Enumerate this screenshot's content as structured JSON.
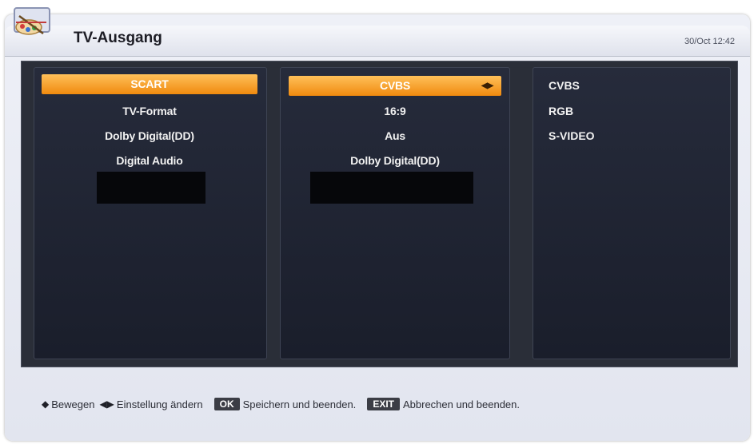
{
  "header": {
    "title": "TV-Ausgang",
    "datetime": "30/Oct 12:42"
  },
  "menu": {
    "left": [
      {
        "label": "SCART",
        "selected": true
      },
      {
        "label": "TV-Format",
        "selected": false
      },
      {
        "label": "Dolby Digital(DD)",
        "selected": false
      },
      {
        "label": "Digital Audio",
        "selected": false
      }
    ],
    "middle": [
      {
        "label": "CVBS",
        "selected": true
      },
      {
        "label": "16:9",
        "selected": false
      },
      {
        "label": "Aus",
        "selected": false
      },
      {
        "label": "Dolby Digital(DD)",
        "selected": false
      }
    ],
    "options": [
      "CVBS",
      "RGB",
      "S-VIDEO"
    ]
  },
  "footer": {
    "move_label": "Bewegen",
    "change_label": "Einstellung ändern",
    "ok_key": "OK",
    "save_label": "Speichern und beenden.",
    "exit_key": "EXIT",
    "cancel_label": "Abbrechen und beenden."
  },
  "colors": {
    "highlight": "#f49a1c",
    "panel": "#20243a"
  }
}
